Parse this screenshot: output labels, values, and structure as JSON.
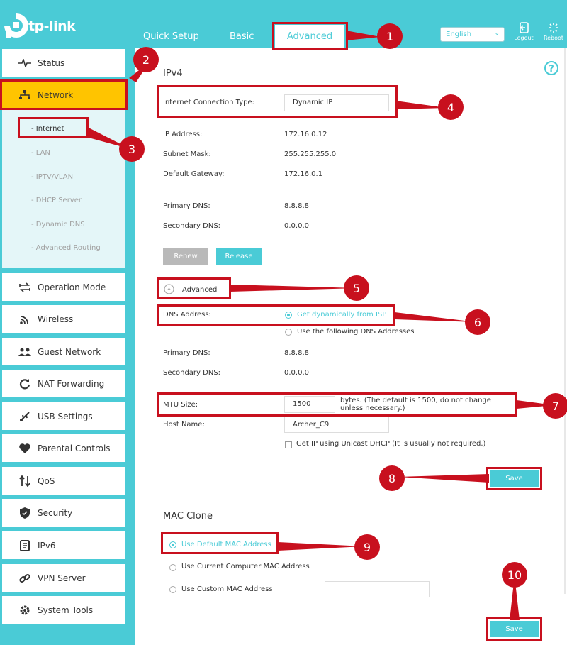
{
  "brand": {
    "name": "tp-link"
  },
  "nav": {
    "tabs": [
      "Quick Setup",
      "Basic",
      "Advanced"
    ],
    "active": "Advanced"
  },
  "header": {
    "language": "English",
    "logout": "Logout",
    "reboot": "Reboot"
  },
  "sidebar": {
    "items": [
      "Status",
      "Network",
      "Operation Mode",
      "Wireless",
      "Guest Network",
      "NAT Forwarding",
      "USB Settings",
      "Parental Controls",
      "QoS",
      "Security",
      "IPv6",
      "VPN Server",
      "System Tools"
    ],
    "active": "Network",
    "network_sub": [
      "- Internet",
      "- LAN",
      "- IPTV/VLAN",
      "- DHCP Server",
      "- Dynamic DNS",
      "- Advanced Routing"
    ]
  },
  "ipv4": {
    "title": "IPv4",
    "conn_type_label": "Internet Connection Type:",
    "conn_type_value": "Dynamic IP",
    "ip_label": "IP Address:",
    "ip_value": "172.16.0.12",
    "mask_label": "Subnet Mask:",
    "mask_value": "255.255.255.0",
    "gw_label": "Default Gateway:",
    "gw_value": "172.16.0.1",
    "pdns_label": "Primary DNS:",
    "pdns_value": "8.8.8.8",
    "sdns_label": "Secondary DNS:",
    "sdns_value": "0.0.0.0",
    "renew": "Renew",
    "release": "Release",
    "advanced_toggle": "Advanced",
    "dns_addr_label": "DNS Address:",
    "dns_opt1": "Get dynamically from ISP",
    "dns_opt2": "Use the following DNS Addresses",
    "pdns2_label": "Primary DNS:",
    "pdns2_value": "8.8.8.8",
    "sdns2_label": "Secondary DNS:",
    "sdns2_value": "0.0.0.0",
    "mtu_label": "MTU Size:",
    "mtu_value": "1500",
    "mtu_note": "bytes. (The default is 1500, do not change unless necessary.)",
    "host_label": "Host Name:",
    "host_value": "Archer_C9",
    "unicast_label": "Get IP using Unicast DHCP (It is usually not required.)",
    "save": "Save"
  },
  "mac": {
    "title": "MAC Clone",
    "opt1": "Use Default MAC Address",
    "opt2": "Use Current Computer MAC Address",
    "opt3": "Use Custom MAC Address",
    "save": "Save"
  },
  "annotations": [
    "1",
    "2",
    "3",
    "4",
    "5",
    "6",
    "7",
    "8",
    "9",
    "10"
  ],
  "colors": {
    "brand": "#4acbd6",
    "active": "#ffc400",
    "annotation": "#c8101e"
  }
}
